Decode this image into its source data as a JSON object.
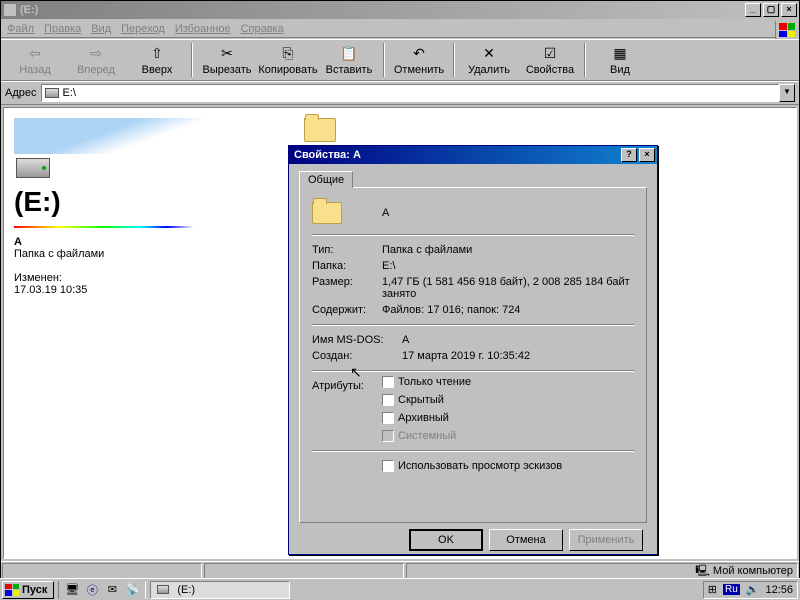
{
  "window": {
    "title": "(E:)",
    "menus": [
      "Файл",
      "Правка",
      "Вид",
      "Переход",
      "Избранное",
      "Справка"
    ],
    "toolbar": {
      "back": "Назад",
      "forward": "Вперед",
      "up": "Вверх",
      "cut": "Вырезать",
      "copy": "Копировать",
      "paste": "Вставить",
      "undo": "Отменить",
      "delete": "Удалить",
      "props": "Свойства",
      "view": "Вид"
    },
    "address_label": "Адрес",
    "address_value": "E:\\"
  },
  "leftpane": {
    "drive_label": "(E:)",
    "item_name": "A",
    "item_type": "Папка с файлами",
    "modified_label": "Изменен:",
    "modified": "17.03.19 10:35"
  },
  "folder_name": "A",
  "dialog": {
    "title": "Свойства: A",
    "tab": "Общие",
    "name": "A",
    "type_lab": "Тип:",
    "type_val": "Папка с файлами",
    "loc_lab": "Папка:",
    "loc_val": "E:\\",
    "size_lab": "Размер:",
    "size_val": "1,47 ГБ (1 581 456 918 байт), 2 008 285 184 байт занято",
    "cont_lab": "Содержит:",
    "cont_val": "Файлов: 17 016; папок: 724",
    "dos_lab": "Имя MS-DOS:",
    "dos_val": "A",
    "created_lab": "Создан:",
    "created_val": "17 марта 2019 г. 10:35:42",
    "attr_lab": "Атрибуты:",
    "attrs": {
      "readonly": "Только чтение",
      "hidden": "Скрытый",
      "archive": "Архивный",
      "system": "Системный"
    },
    "thumb": "Использовать просмотр эскизов",
    "ok": "OK",
    "cancel": "Отмена",
    "apply": "Применить"
  },
  "statusbar": {
    "mycomputer": "Мой компьютер"
  },
  "taskbar": {
    "start": "Пуск",
    "task": "(E:)",
    "lang": "Ru",
    "clock": "12:56"
  }
}
